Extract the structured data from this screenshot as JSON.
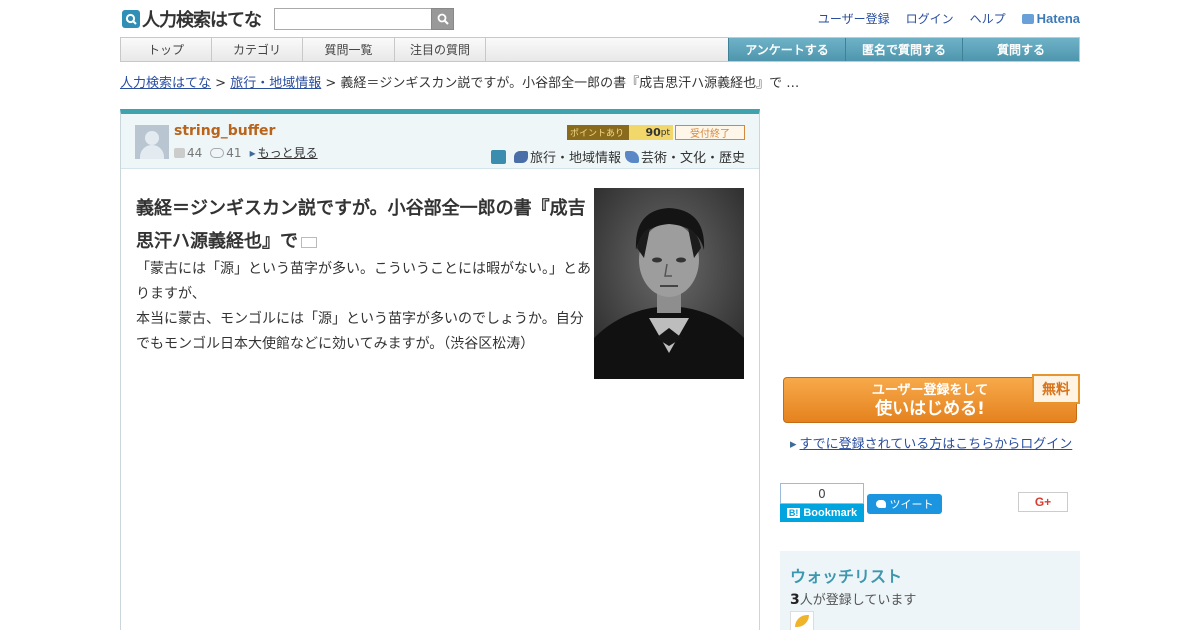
{
  "header": {
    "logo_text": "人力検索はてな",
    "search_placeholder": "",
    "links": [
      "ユーザー登録",
      "ログイン",
      "ヘルプ"
    ],
    "hatena_brand": "Hatena"
  },
  "nav": {
    "left": [
      "トップ",
      "カテゴリ",
      "質問一覧",
      "注目の質問"
    ],
    "right": [
      "アンケートする",
      "匿名で質問する",
      "質問する"
    ]
  },
  "breadcrumb": {
    "home": "人力検索はてな",
    "sep": ">",
    "category": "旅行・地域情報",
    "current": "義経＝ジンギスカン説ですが。小谷部全一郎の書『成吉思汗ハ源義経也』で …"
  },
  "question": {
    "username": "string_buffer",
    "stat_questions": "44",
    "stat_answers": "41",
    "more_link": "もっと見る",
    "point_label": "ポイントあり",
    "point_value": "90",
    "point_unit": "pt",
    "status": "受付終了",
    "categories": [
      "旅行・地域情報",
      "芸術・文化・歴史"
    ],
    "title": "義経＝ジンギスカン説ですが。小谷部全一郎の書『成吉思汗ハ源義経也』で",
    "body_1": "「蒙古には「源」という苗字が多い。こういうことには暇がない。」とありますが、",
    "body_2": "本当に蒙古、モンゴルには「源」という苗字が多いのでしょうか。自分でもモンゴル日本大使館などに効いてみますが。（渋谷区松涛）"
  },
  "sidebar": {
    "signup_line1": "ユーザー登録をして",
    "signup_line2": "使いはじめる!",
    "free_label": "無料",
    "login_link": "すでに登録されている方はこちらからログイン",
    "bookmark_count": "0",
    "bookmark_label": "Bookmark",
    "tweet_label": "ツイート",
    "gplus_label": "G+",
    "watchlist_title": "ウォッチリスト",
    "watch_count": "3",
    "watch_text": "人が登録しています"
  },
  "colors": {
    "accent": "#3ea3ad",
    "username": "#b9631b",
    "link": "#2a4e9e",
    "signup": "#e5821f"
  }
}
